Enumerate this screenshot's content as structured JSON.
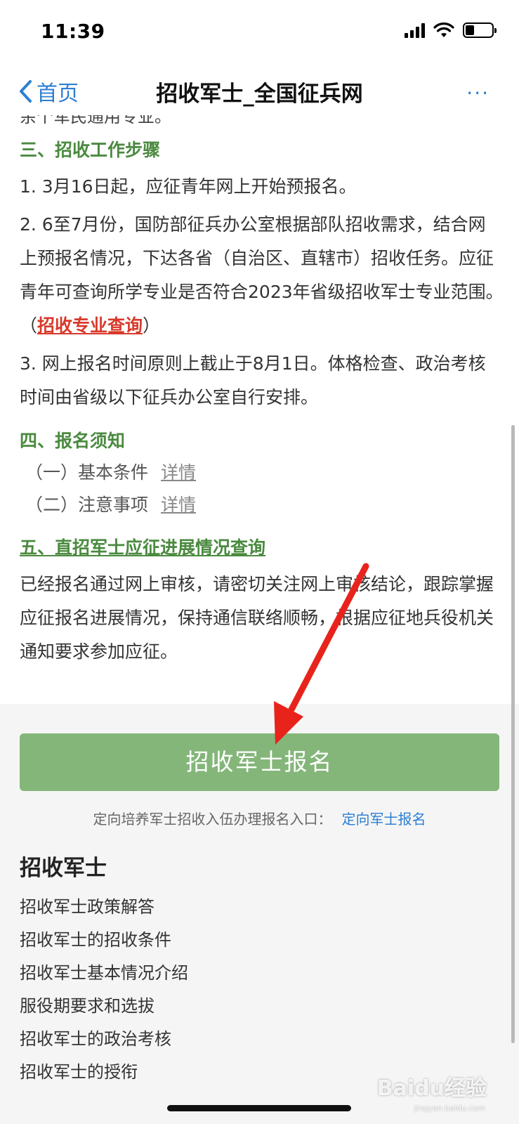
{
  "status_bar": {
    "time": "11:39"
  },
  "nav": {
    "back_label": "首页",
    "title": "招收军士_全国征兵网",
    "more_label": "···"
  },
  "article": {
    "clipped_line": "余个军民通用专业。",
    "section3_title": "三、招收工作步骤",
    "step1": "1. 3月16日起，应征青年网上开始预报名。",
    "step2_text": "2. 6至7月份，国防部征兵办公室根据部队招收需求，结合网上预报名情况，下达各省（自治区、直辖市）招收任务。应征青年可查询所学专业是否符合2023年省级招收军士专业范围。　（",
    "step2_link": "招收专业查询",
    "step2_close": "）",
    "step3": "3. 网上报名时间原则上截止于8月1日。体格检查、政治考核时间由省级以下征兵办公室自行安排。",
    "section4_title": "四、报名须知",
    "notice_items": [
      {
        "label": "（一）基本条件",
        "detail": "详情"
      },
      {
        "label": "（二）注意事项",
        "detail": "详情"
      }
    ],
    "section5_title": "五、直招军士应征进展情况查询",
    "section5_text": "已经报名通过网上审核，请密切关注网上审核结论，跟踪掌握应征报名进展情况，保持通信联络顺畅，根据应征地兵役机关通知要求参加应征。"
  },
  "bottom": {
    "enroll_button": "招收军士报名",
    "direct_text": "定向培养军士招收入伍办理报名入口：",
    "direct_link": "定向军士报名",
    "section_title": "招收军士",
    "links": [
      "招收军士政策解答",
      "招收军士的招收条件",
      "招收军士基本情况介绍",
      "服役期要求和选拔",
      "招收军士的政治考核",
      "招收军士的授衔"
    ]
  },
  "watermark": {
    "main": "Baidu经验",
    "sub": "jingyan.baidu.com"
  },
  "colors": {
    "accent_blue": "#2d7fd3",
    "heading_green": "#4a8a3f",
    "button_green": "#84b67a",
    "link_red": "#d9392b",
    "arrow_red": "#e8231c"
  }
}
